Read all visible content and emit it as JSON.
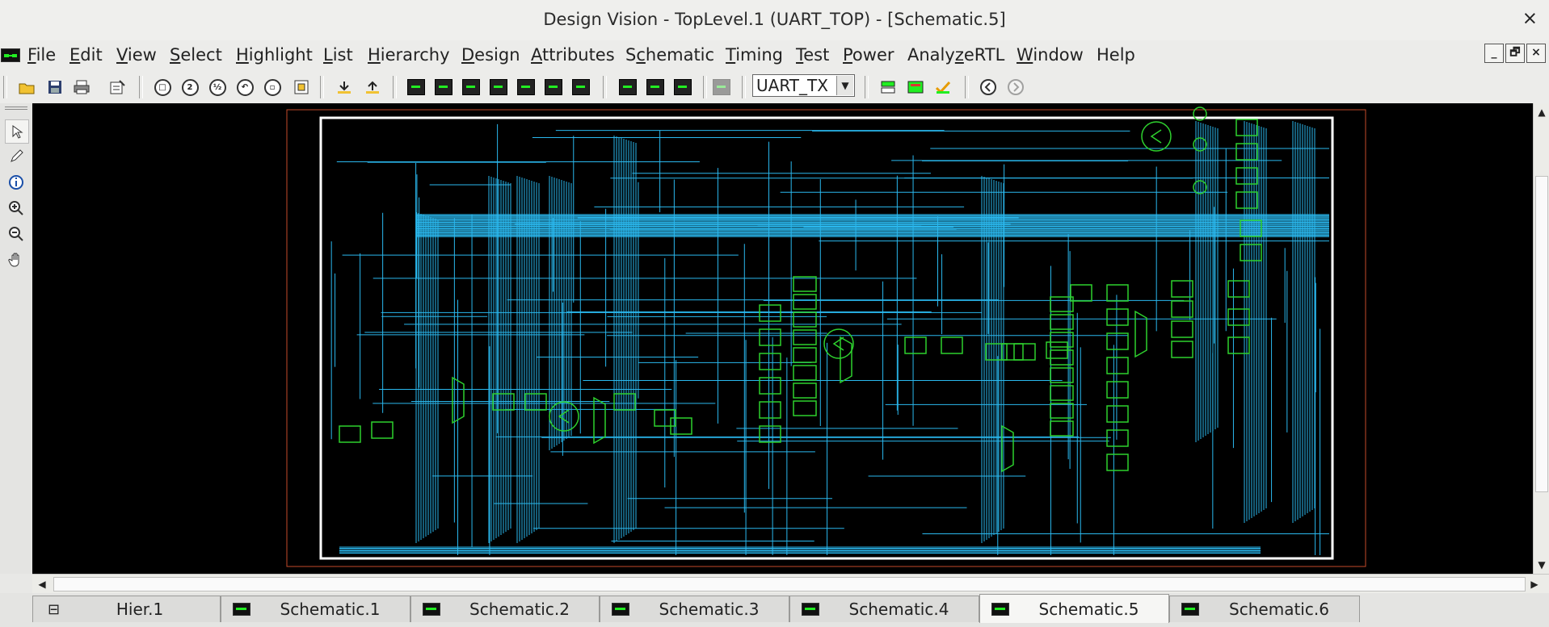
{
  "window": {
    "title": "Design Vision - TopLevel.1 (UART_TOP) - [Schematic.5]",
    "close": "×"
  },
  "menu": [
    {
      "pre": "",
      "u": "F",
      "post": "ile"
    },
    {
      "pre": "",
      "u": "E",
      "post": "dit"
    },
    {
      "pre": "",
      "u": "V",
      "post": "iew"
    },
    {
      "pre": "",
      "u": "S",
      "post": "elect"
    },
    {
      "pre": "",
      "u": "H",
      "post": "ighlight"
    },
    {
      "pre": "",
      "u": "L",
      "post": "ist"
    },
    {
      "pre": "",
      "u": "H",
      "post": "ierarchy"
    },
    {
      "pre": "",
      "u": "D",
      "post": "esign"
    },
    {
      "pre": "",
      "u": "A",
      "post": "ttributes"
    },
    {
      "pre": "S",
      "u": "c",
      "post": "hematic"
    },
    {
      "pre": "",
      "u": "T",
      "post": "iming"
    },
    {
      "pre": "",
      "u": "T",
      "post": "est"
    },
    {
      "pre": "",
      "u": "P",
      "post": "ower"
    },
    {
      "pre": "Analy",
      "u": "z",
      "post": "eRTL"
    },
    {
      "pre": "",
      "u": "W",
      "post": "indow"
    },
    {
      "pre": "",
      "u": "",
      "post": "Help"
    }
  ],
  "mdi_controls": [
    "_",
    "🗗",
    "×"
  ],
  "toolbar": {
    "design_select": "UART_TX"
  },
  "tabs": [
    {
      "label": "Hier.1",
      "type": "hier",
      "active": false
    },
    {
      "label": "Schematic.1",
      "type": "schematic",
      "active": false
    },
    {
      "label": "Schematic.2",
      "type": "schematic",
      "active": false
    },
    {
      "label": "Schematic.3",
      "type": "schematic",
      "active": false
    },
    {
      "label": "Schematic.4",
      "type": "schematic",
      "active": false
    },
    {
      "label": "Schematic.5",
      "type": "schematic",
      "active": true
    },
    {
      "label": "Schematic.6",
      "type": "schematic",
      "active": false
    }
  ],
  "schematic": {
    "cells": 58,
    "wire_color": "#2ab8ee",
    "cell_color": "#2ed12e",
    "boundary_color": "#ffffff",
    "frame_color": "#c44a2a"
  }
}
